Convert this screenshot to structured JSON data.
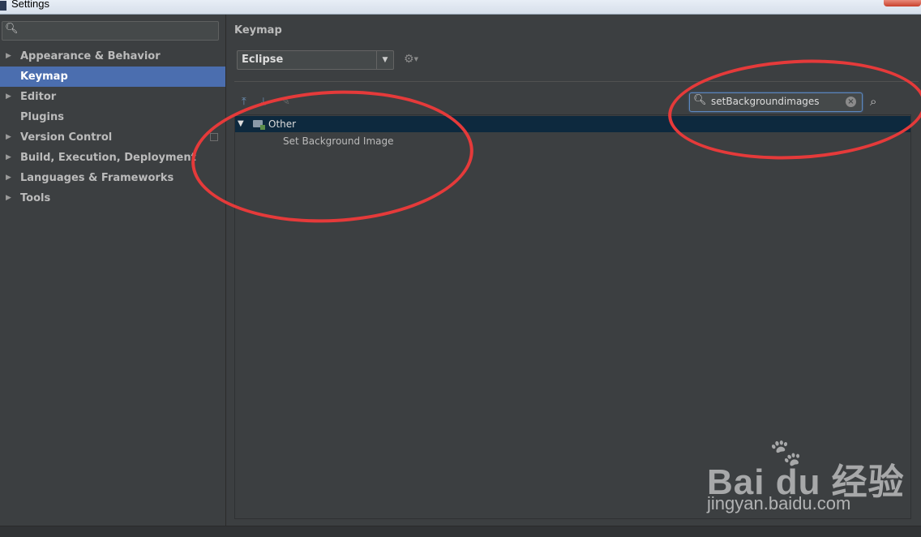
{
  "window": {
    "title": "Settings"
  },
  "sidebar": {
    "search_placeholder": "",
    "items": [
      {
        "label": "Appearance & Behavior",
        "expandable": true
      },
      {
        "label": "Keymap",
        "expandable": false,
        "selected": true
      },
      {
        "label": "Editor",
        "expandable": true
      },
      {
        "label": "Plugins",
        "expandable": false
      },
      {
        "label": "Version Control",
        "expandable": true
      },
      {
        "label": "Build, Execution, Deployment",
        "expandable": true
      },
      {
        "label": "Languages & Frameworks",
        "expandable": true
      },
      {
        "label": "Tools",
        "expandable": true
      }
    ]
  },
  "main": {
    "title": "Keymap",
    "keymap_select": {
      "value": "Eclipse"
    },
    "filter": {
      "value": "setBackgroundimages"
    },
    "tree": {
      "group": {
        "label": "Other",
        "expanded": true
      },
      "items": [
        {
          "label": "Set Background Image"
        }
      ]
    }
  },
  "watermark": {
    "logo": "Bai du 经验",
    "url": "jingyan.baidu.com"
  },
  "colors": {
    "background": "#3c3f41",
    "selection": "#4b6eaf",
    "tree_group_bg": "#0d293e",
    "annotation": "#e53a3a"
  },
  "icons": [
    "search-icon",
    "chevron-down-icon",
    "gear-icon",
    "expand-all-icon",
    "collapse-all-icon",
    "pencil-icon",
    "clear-icon",
    "find-shortcut-icon",
    "folder-icon"
  ]
}
